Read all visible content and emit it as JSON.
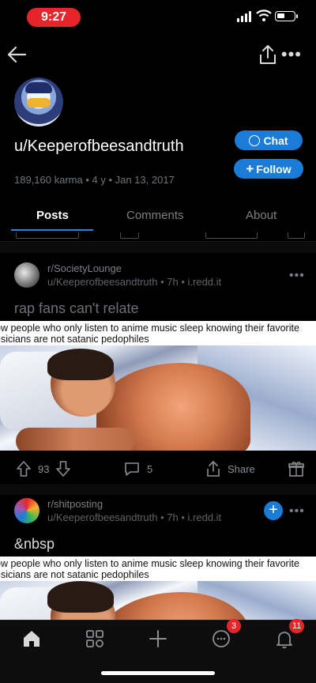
{
  "status_bar": {
    "time": "9:27"
  },
  "profile": {
    "username": "u/Keeperofbeesandtruth",
    "stats": "189,160 karma • 4 y • Jan 13, 2017",
    "chat_label": "Chat",
    "follow_label": "Follow"
  },
  "tabs": [
    {
      "label": "Posts",
      "active": true
    },
    {
      "label": "Comments",
      "active": false
    },
    {
      "label": "About",
      "active": false
    }
  ],
  "posts": [
    {
      "subreddit": "r/SocietyLounge",
      "byline": "u/Keeperofbeesandtruth • 7h • i.redd.it",
      "title": "rap fans can't relate",
      "caption_line1": "ow people who only listen to anime music sleep knowing their favorite",
      "caption_line2": "usicians are not satanic pedophiles",
      "upvotes": "93",
      "comments": "5",
      "share_label": "Share"
    },
    {
      "subreddit": "r/shitposting",
      "byline": "u/Keeperofbeesandtruth • 7h • i.redd.it",
      "title": "&nbsp",
      "caption_line1": "ow people who only listen to anime music sleep knowing their favorite",
      "caption_line2": "usicians are not satanic pedophiles"
    }
  ],
  "bottom_nav": {
    "chat_badge": "3",
    "inbox_badge": "11"
  },
  "colors": {
    "accent": "#1a7cd6",
    "badge": "#e5252a",
    "background": "#000000"
  }
}
